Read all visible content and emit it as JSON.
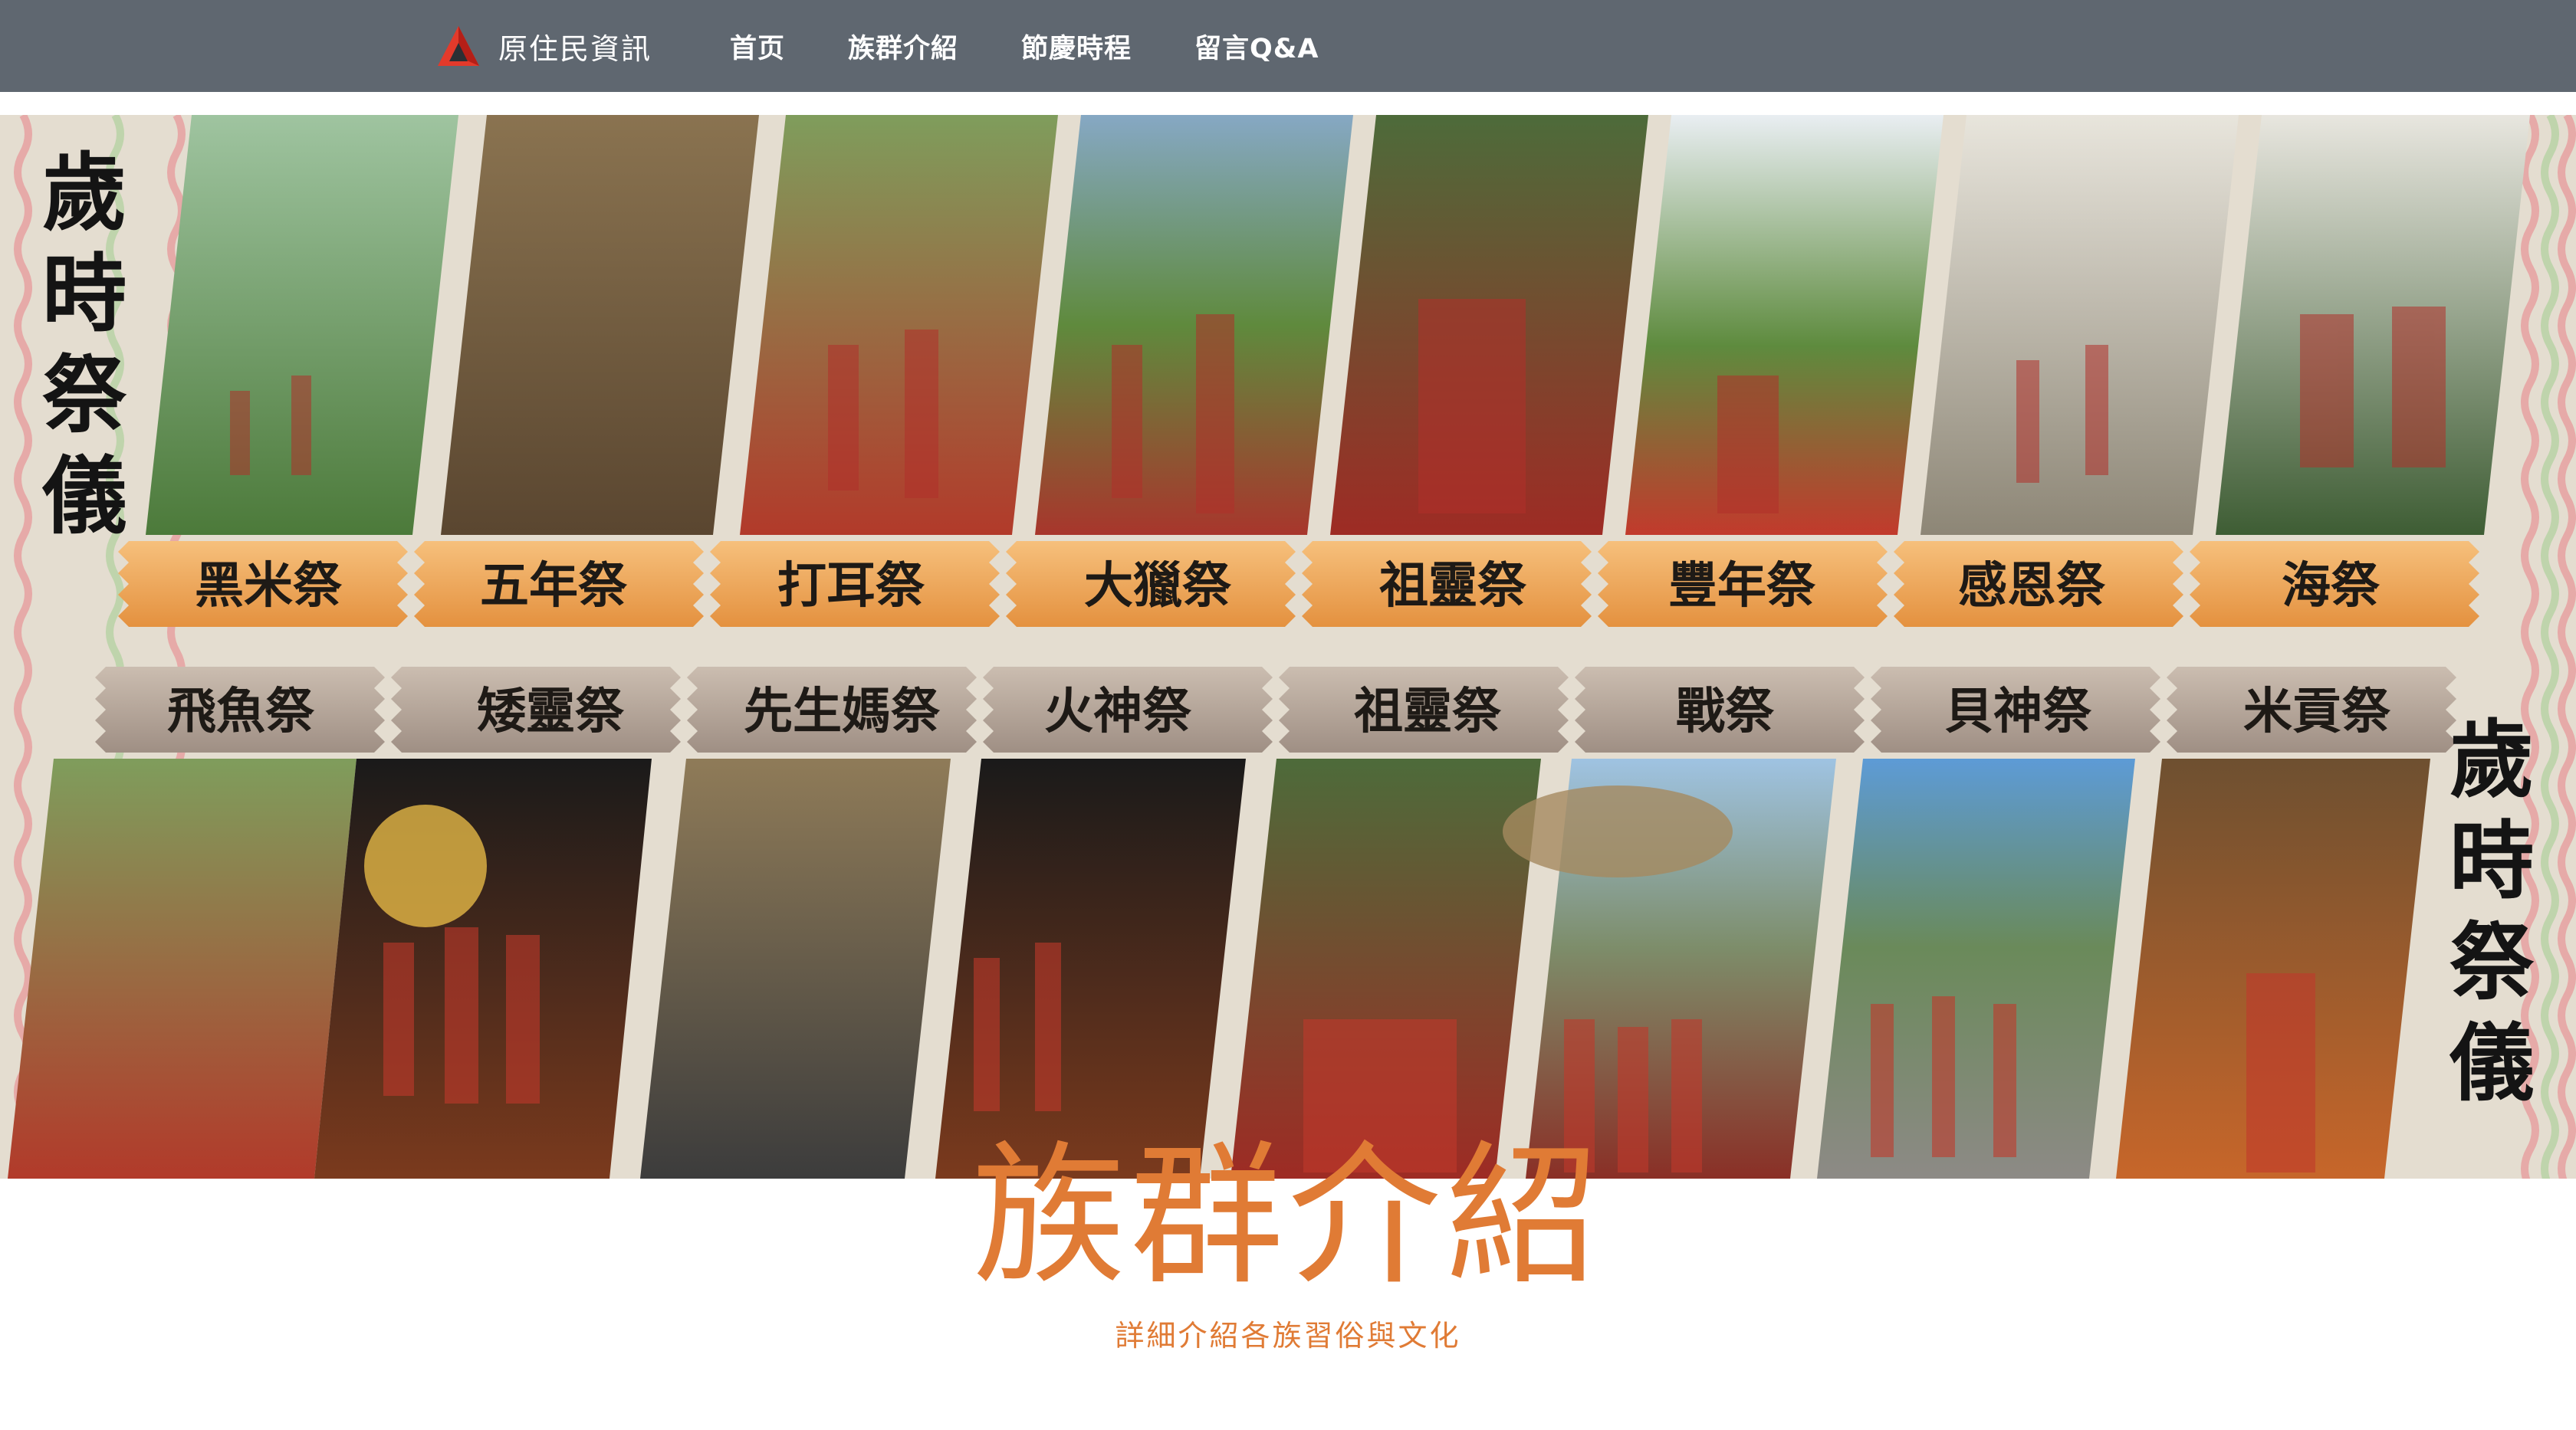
{
  "nav": {
    "brand_name": "原住民資訊",
    "logo_icon": "red-triangle-logo",
    "items": [
      {
        "label": "首页"
      },
      {
        "label": "族群介紹"
      },
      {
        "label": "節慶時程"
      },
      {
        "label": "留言Q&A"
      }
    ]
  },
  "banner": {
    "vertical_title": "歲時祭儀",
    "festivals_top": [
      "黑米祭",
      "五年祭",
      "打耳祭",
      "大獵祭",
      "祖靈祭",
      "豐年祭",
      "感恩祭",
      "海祭"
    ],
    "festivals_bottom": [
      "飛魚祭",
      "矮靈祭",
      "先生媽祭",
      "火神祭",
      "祖靈祭",
      "戰祭",
      "貝神祭",
      "米貢祭"
    ]
  },
  "section": {
    "title": "族群介紹",
    "subtitle": "詳細介紹各族習俗與文化"
  },
  "colors": {
    "navbar": "#5f6770",
    "accent": "#e07b35",
    "chip_top": "#f0a95a",
    "chip_bottom": "#b4a59a"
  }
}
